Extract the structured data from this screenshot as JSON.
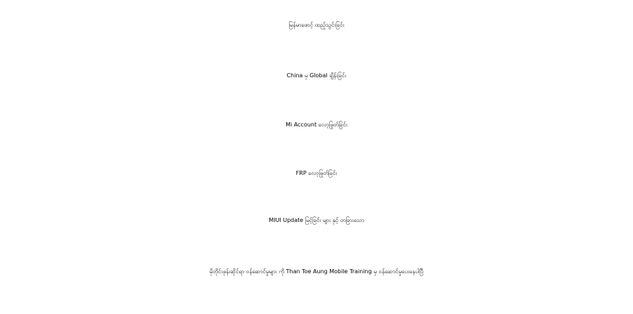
{
  "headlines": [
    "မြန်မာဖောင့် ထည့်သွင်းခြင်း",
    "China မှ Global ချိန်းခြင်း",
    "Mi Account လော့ဖြုတ်ခြင်း",
    "FRP လော့ဖြုတ်ခြင်း",
    "MIUI Update မြင့်ခြင်း များ နှင့် တခြားသော"
  ],
  "footer": "မိုဘိုင်းဖုန်းဆိုင်ရာ ဝန်ဆောင်မှုများ ကို Than Toe Aung Mobile Training မှ ဝန်ဆောင်မှုပေးနေပါပြီ"
}
